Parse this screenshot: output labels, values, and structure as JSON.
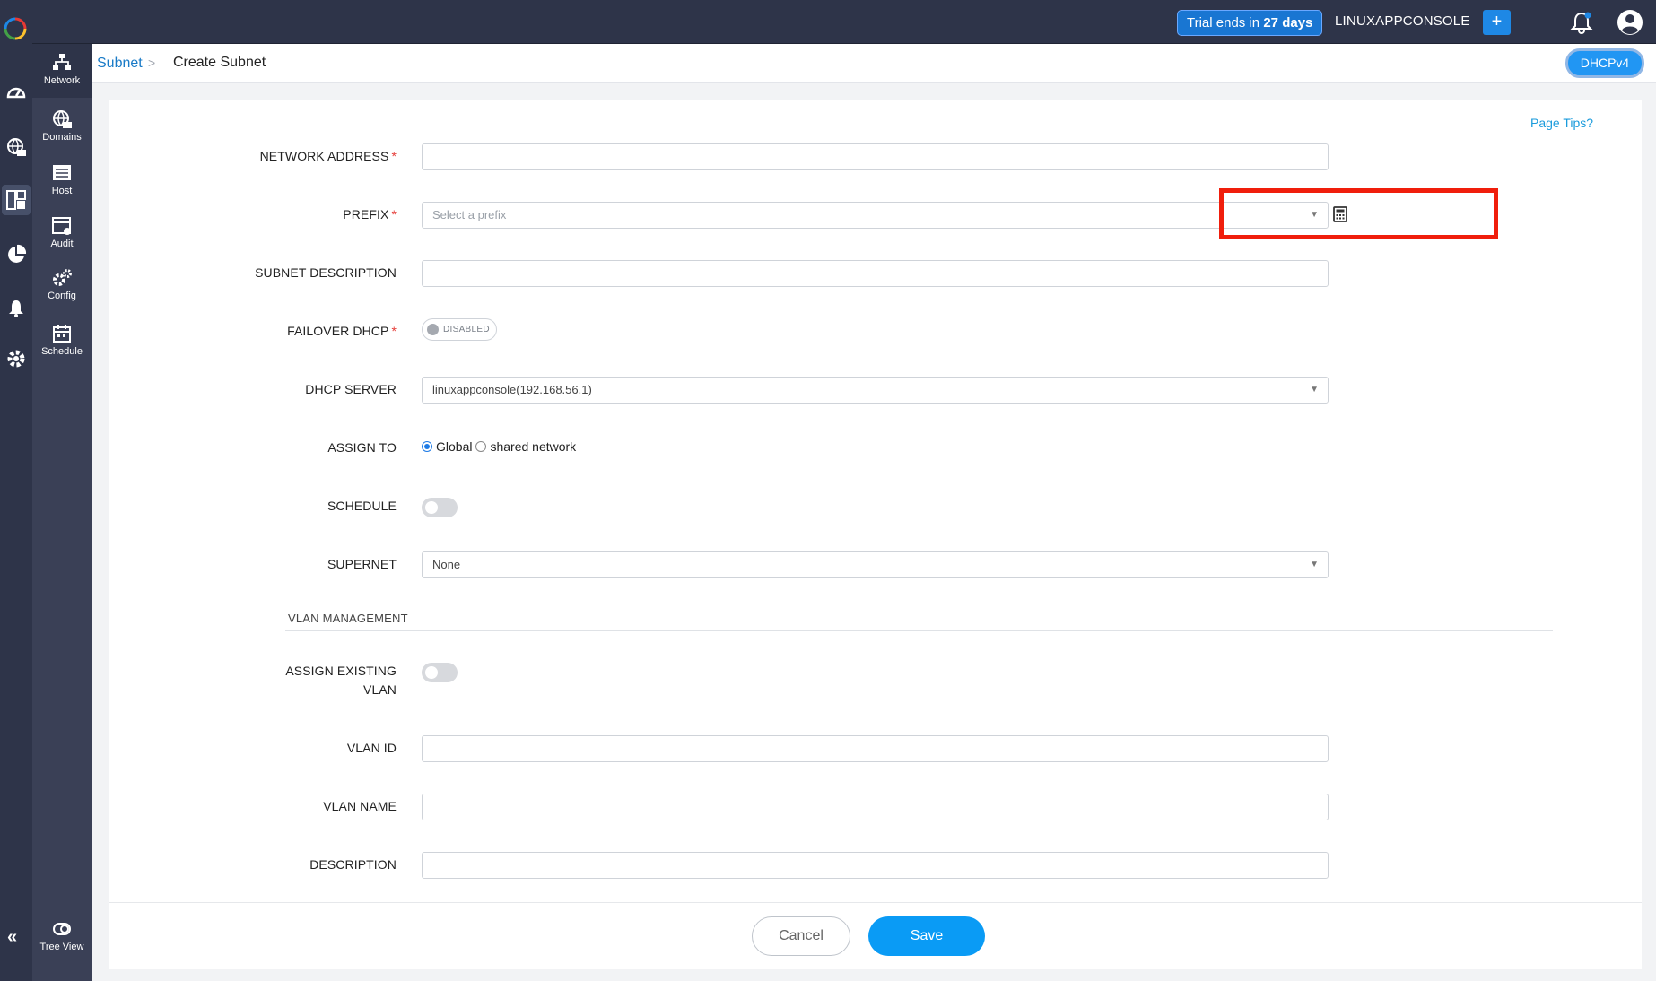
{
  "topbar": {
    "trial_prefix": "Trial ends in",
    "trial_days": "27",
    "trial_suffix": "days",
    "account": "LINUXAPPCONSOLE",
    "add_label": "+"
  },
  "left_nav": {
    "icons": [
      "dashboard-icon",
      "dns-icon",
      "ipam-icon",
      "reports-icon",
      "alarms-icon",
      "settings-icon"
    ],
    "items": [
      {
        "label": "Network",
        "icon": "network-icon"
      },
      {
        "label": "Domains",
        "icon": "domains-icon"
      },
      {
        "label": "Host",
        "icon": "host-icon"
      },
      {
        "label": "Audit",
        "icon": "audit-icon"
      },
      {
        "label": "Config",
        "icon": "config-icon"
      },
      {
        "label": "Schedule",
        "icon": "schedule-icon"
      }
    ],
    "tree_view": "Tree View",
    "collapse": "«"
  },
  "breadcrumb": {
    "parent": "Subnet",
    "separator": ">",
    "current": "Create Subnet"
  },
  "protocol_button": "DHCPv4",
  "page_tips": "Page Tips?",
  "form": {
    "network_address": {
      "label": "NETWORK ADDRESS",
      "value": ""
    },
    "prefix": {
      "label": "PREFIX",
      "placeholder": "Select a prefix"
    },
    "subnet_description": {
      "label": "SUBNET DESCRIPTION",
      "value": ""
    },
    "failover_dhcp": {
      "label": "FAILOVER DHCP",
      "state": "DISABLED"
    },
    "dhcp_server": {
      "label": "DHCP SERVER",
      "value": "linuxappconsole(192.168.56.1)"
    },
    "assign_to": {
      "label": "ASSIGN TO",
      "options": [
        "Global",
        "shared network"
      ],
      "selected": "Global"
    },
    "schedule": {
      "label": "SCHEDULE",
      "enabled": false
    },
    "supernet": {
      "label": "SUPERNET",
      "value": "None"
    },
    "vlan_section": "VLAN MANAGEMENT",
    "assign_existing_vlan": {
      "label_line1": "ASSIGN EXISTING",
      "label_line2": "VLAN",
      "enabled": false
    },
    "vlan_id": {
      "label": "VLAN ID",
      "value": ""
    },
    "vlan_name": {
      "label": "VLAN NAME",
      "value": ""
    },
    "description": {
      "label": "DESCRIPTION",
      "value": ""
    },
    "required_mark": "*"
  },
  "actions": {
    "cancel": "Cancel",
    "save": "Save"
  },
  "colors": {
    "accent": "#0a9bf5",
    "nav": "#2e3449",
    "highlight": "#f01e0c",
    "required": "#e53935"
  }
}
